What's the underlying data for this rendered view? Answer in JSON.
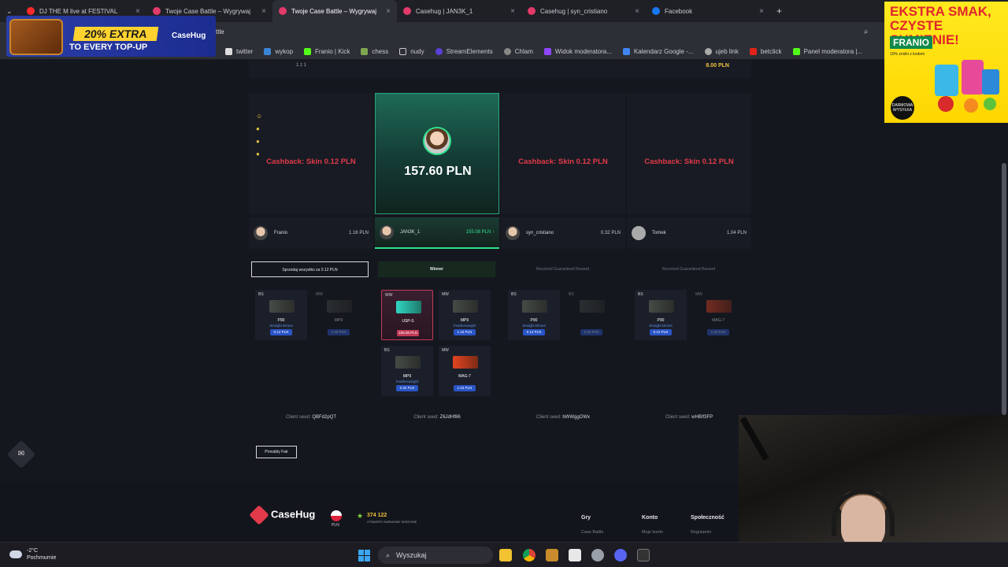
{
  "browser": {
    "tabs": [
      {
        "label": "DJ THE M live at FESTIVAL",
        "color": "#ff2b2b"
      },
      {
        "label": "Twoje Case Battle – Wygrywaj",
        "color": "#e23a6a"
      },
      {
        "label": "Twoje Case Battle – Wygrywaj",
        "color": "#e23a6a"
      },
      {
        "label": "Casehug | JAN3K_1",
        "color": "#e23a6a"
      },
      {
        "label": "Casehug | syn_cristiano",
        "color": "#e23a6a"
      },
      {
        "label": "Facebook",
        "color": "#1877f2"
      }
    ],
    "new_tab": "+",
    "url": "ttle",
    "bookmarks": [
      "twitter",
      "wykop",
      "Franio | Kick",
      "chess",
      "nudy",
      "StreamElements",
      "Chlam",
      "Widok moderatora...",
      "Kalendarz Google -...",
      "ujeb link",
      "betclick",
      "Panel moderatora |..."
    ]
  },
  "ads": {
    "left": {
      "badge": "20% EXTRA",
      "sub": "TO EVERY TOP-UP",
      "logo": "CaseHug"
    },
    "right": {
      "headline": "EKSTRA SMAK, CZYSTE SUMIENIE!",
      "brand": "FRANIO",
      "tag": "10% zniżki z kodem",
      "free": "DARMOWA WYSYŁKA"
    }
  },
  "top_strip": {
    "left": "1 z 1",
    "right": "8.00 PLN"
  },
  "battle": {
    "reels": [
      {
        "cashback": "Cashback: Skin 0.12 PLN"
      },
      {
        "win": "157.60 PLN"
      },
      {
        "cashback": "Cashback: Skin 0.12 PLN"
      },
      {
        "cashback": "Cashback: Skin 0.12 PLN"
      }
    ],
    "players": [
      {
        "name": "Franio",
        "value": "1.16 PLN"
      },
      {
        "name": "JAN3K_1",
        "value": "155.08 PLN ↑"
      },
      {
        "name": "syn_cristiano",
        "value": "0.32 PLN"
      },
      {
        "name": "Tomek",
        "value": "1.04 PLN"
      }
    ],
    "actions": [
      "Sprzedaj wszystko za 0.12 PLN",
      "Winner",
      "Received Guaranteed Reward",
      "Received Guaranteed Reward"
    ],
    "items": [
      {
        "cond": "BS",
        "name": "P90",
        "skin": "Straight Dimes",
        "price": "0.12 PLN"
      },
      {
        "cond": "MW",
        "name": "MP9",
        "skin": "",
        "price": "1.16 PLN"
      },
      {
        "cond": "WW",
        "name": "USP-S",
        "skin": "",
        "price": "155.08 PLN"
      },
      {
        "cond": "MW",
        "name": "MP9",
        "skin": "Featherweight",
        "price": "1.16 PLN"
      },
      {
        "cond": "BS",
        "name": "MP9",
        "skin": "Featherweight",
        "price": "0.32 PLN"
      },
      {
        "cond": "MW",
        "name": "MAG-7",
        "skin": "",
        "price": "1.04 PLN"
      },
      {
        "cond": "BS",
        "name": "P90",
        "skin": "Straight Dimes",
        "price": "0.12 PLN"
      },
      {
        "cond": "BS",
        "name": "",
        "skin": "",
        "price": "0.32 PLN"
      },
      {
        "cond": "BS",
        "name": "P90",
        "skin": "Straight Dimes",
        "price": "0.12 PLN"
      },
      {
        "cond": "MW",
        "name": "MAG-7",
        "skin": "",
        "price": "1.04 PLN"
      }
    ],
    "seed_label": "Client seed:",
    "seeds": [
      "QBFd2pQT",
      "Z6JdHf86",
      "bWWggOWx",
      "wHBIf3FP"
    ],
    "provably": "Provably Fair"
  },
  "footer": {
    "logo": "CaseHug",
    "currency": "PLN",
    "count": "374 122",
    "count_label": "OTWARTE DARMOWE SKRZYNIE",
    "cols": [
      {
        "head": "Gry",
        "link": "Case Battle"
      },
      {
        "head": "Konto",
        "link": "Moje konto"
      },
      {
        "head": "Społeczność",
        "link": "Regulamin"
      }
    ]
  },
  "taskbar": {
    "temp": "-2°C",
    "weather": "Pochmurnie",
    "search": "Wyszukaj"
  }
}
